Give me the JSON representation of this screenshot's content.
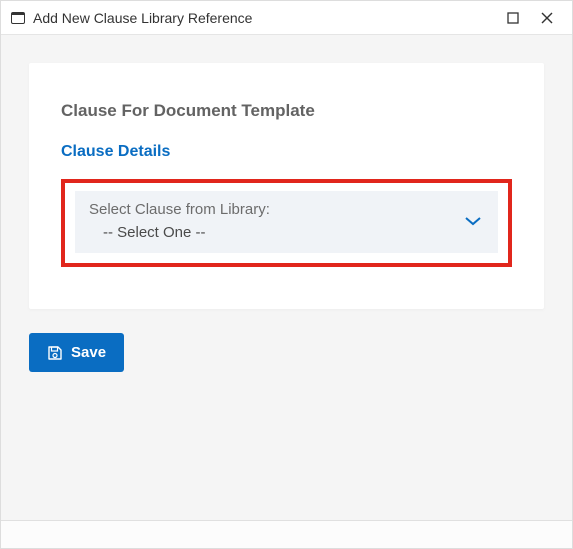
{
  "window": {
    "title": "Add New Clause Library Reference"
  },
  "card": {
    "heading": "Clause For Document Template",
    "section_title": "Clause Details",
    "select": {
      "label": "Select Clause from Library:",
      "value": "-- Select One --"
    }
  },
  "actions": {
    "save_label": "Save"
  },
  "colors": {
    "accent": "#0a6dc2",
    "highlight_border": "#e1261c"
  }
}
